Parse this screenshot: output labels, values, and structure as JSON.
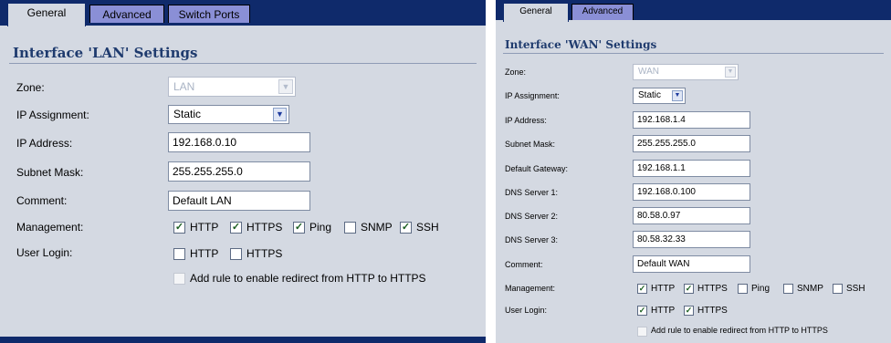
{
  "left": {
    "tabs": [
      "General",
      "Advanced",
      "Switch Ports"
    ],
    "title": "Interface 'LAN' Settings",
    "zone": {
      "label": "Zone:",
      "value": "LAN"
    },
    "ip_assignment": {
      "label": "IP Assignment:",
      "value": "Static"
    },
    "ip_address": {
      "label": "IP Address:",
      "value": "192.168.0.10"
    },
    "subnet_mask": {
      "label": "Subnet Mask:",
      "value": "255.255.255.0"
    },
    "comment": {
      "label": "Comment:",
      "value": "Default LAN"
    },
    "management": {
      "label": "Management:",
      "options": [
        {
          "label": "HTTP",
          "checked": true
        },
        {
          "label": "HTTPS",
          "checked": true
        },
        {
          "label": "Ping",
          "checked": true
        },
        {
          "label": "SNMP",
          "checked": false
        },
        {
          "label": "SSH",
          "checked": true
        }
      ]
    },
    "user_login": {
      "label": "User Login:",
      "options": [
        {
          "label": "HTTP",
          "checked": false
        },
        {
          "label": "HTTPS",
          "checked": false
        }
      ]
    },
    "redirect": {
      "label": "Add rule to enable redirect from HTTP to HTTPS",
      "checked": false
    }
  },
  "right": {
    "tabs": [
      "General",
      "Advanced"
    ],
    "title": "Interface 'WAN' Settings",
    "zone": {
      "label": "Zone:",
      "value": "WAN"
    },
    "ip_assignment": {
      "label": "IP Assignment:",
      "value": "Static"
    },
    "ip_address": {
      "label": "IP Address:",
      "value": "192.168.1.4"
    },
    "subnet_mask": {
      "label": "Subnet Mask:",
      "value": "255.255.255.0"
    },
    "default_gateway": {
      "label": "Default Gateway:",
      "value": "192.168.1.1"
    },
    "dns1": {
      "label": "DNS Server 1:",
      "value": "192.168.0.100"
    },
    "dns2": {
      "label": "DNS Server 2:",
      "value": "80.58.0.97"
    },
    "dns3": {
      "label": "DNS Server 3:",
      "value": "80.58.32.33"
    },
    "comment": {
      "label": "Comment:",
      "value": "Default WAN"
    },
    "management": {
      "label": "Management:",
      "options": [
        {
          "label": "HTTP",
          "checked": true
        },
        {
          "label": "HTTPS",
          "checked": true
        },
        {
          "label": "Ping",
          "checked": false
        },
        {
          "label": "SNMP",
          "checked": false
        },
        {
          "label": "SSH",
          "checked": false
        }
      ]
    },
    "user_login": {
      "label": "User Login:",
      "options": [
        {
          "label": "HTTP",
          "checked": true
        },
        {
          "label": "HTTPS",
          "checked": true
        }
      ]
    },
    "redirect": {
      "label": "Add rule to enable redirect from HTTP to HTTPS",
      "checked": false
    }
  }
}
